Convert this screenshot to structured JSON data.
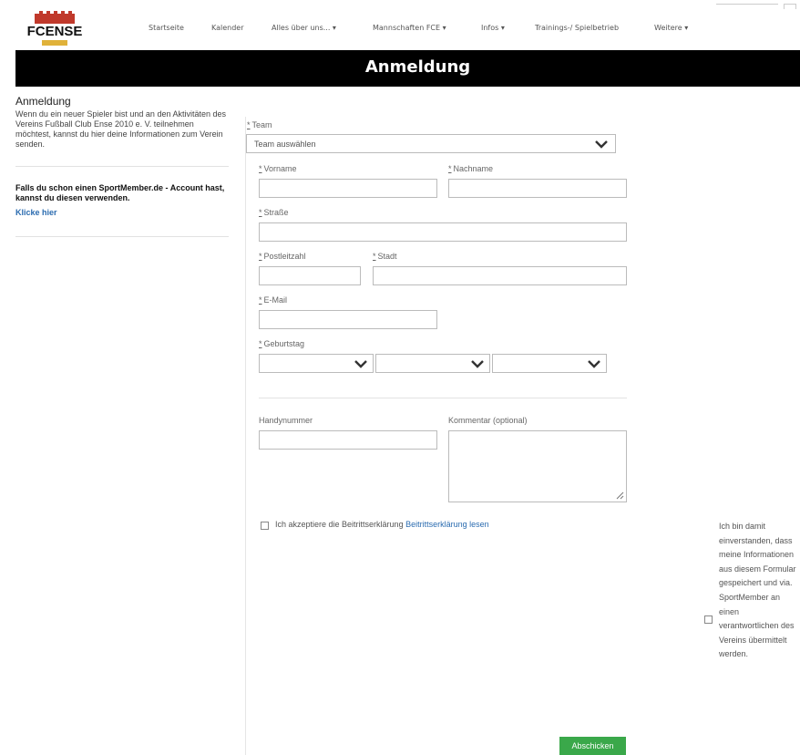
{
  "header": {
    "logo_name": "FCENSE",
    "nav": [
      "Startseite",
      "Kalender",
      "Alles über uns... ▾",
      "Mannschaften FCE ▾",
      "Infos ▾",
      "Trainings-/ Spielbetrieb",
      "Weitere ▾"
    ]
  },
  "banner": {
    "title": "Anmeldung"
  },
  "sidebar": {
    "title": "Anmeldung",
    "intro": "Wenn du ein neuer Spieler bist und an den Aktivitäten des Vereins Fußball Club Ense 2010 e. V. teilnehmen möchtest, kannst du hier deine Informationen zum Verein senden.",
    "account_text": "Falls du schon einen SportMember.de - Account hast, kannst du diesen verwenden.",
    "account_link": "Klicke hier"
  },
  "form": {
    "required_mark": "*",
    "team_label": "Team",
    "team_placeholder": "Team auswählen",
    "firstname_label": "Vorname",
    "lastname_label": "Nachname",
    "street_label": "Straße",
    "zip_label": "Postleitzahl",
    "city_label": "Stadt",
    "email_label": "E-Mail",
    "birthday_label": "Geburtstag",
    "mobile_label": "Handynummer",
    "comment_label": "Kommentar (optional)",
    "terms_text": "Ich akzeptiere die Beitrittserklärung",
    "terms_link": "Beitrittserklärung lesen",
    "consent_text": "Ich bin damit einverstanden, dass meine Informationen aus diesem Formular gespeichert und via. SportMember an einen verantwortlichen des Vereins übermittelt werden.",
    "submit_label": "Abschicken"
  },
  "colors": {
    "banner": "#000000",
    "link": "#2b6cb0",
    "submit": "#3aa84a",
    "logo_red": "#c0392b",
    "logo_gold": "#e0b23a"
  },
  "icons": {
    "dropdown": "chevron-down-icon"
  }
}
